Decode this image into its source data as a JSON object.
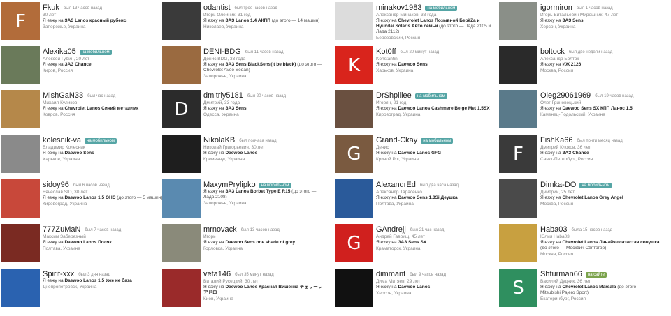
{
  "cards": [
    {
      "username": "Fkuk",
      "ago": "был 13 часов назад",
      "badge": "",
      "name": "30 лет",
      "car_prefix": "Я езжу на",
      "car": "ЗАЗ Lanos красный рубенс",
      "prev": "",
      "location": "Запорожье, Украина",
      "avatar_letter": "F",
      "avatar_color": "#b26c3a"
    },
    {
      "username": "odantist",
      "ago": "был трое часов назад",
      "badge": "",
      "name": "Игорь Олейник, 31 год",
      "car_prefix": "Я езжу на",
      "car": "ЗАЗ Lanos 1.4 АКПП",
      "prev": "(до этого — 14 машин)",
      "location": "Николаев, Украина",
      "avatar_letter": "",
      "avatar_color": "#3a3a3a"
    },
    {
      "username": "minakov1983",
      "ago": "",
      "badge": "на мобильном",
      "name": "Александр Минаков, 33 года",
      "car_prefix": "Я езжу на",
      "car": "Chevrolet Lanos Позывной БерёZа и Hyundai Solaris Авто семьи",
      "prev": "(до этого — Лада 2105 и Лада 2112)",
      "location": "Березовский, Россия",
      "avatar_letter": "",
      "avatar_color": "#dcdcdc"
    },
    {
      "username": "igormiron",
      "ago": "был 1 часов назад",
      "badge": "",
      "name": "Игорь Витальевич Мирошник, 47 лет",
      "car_prefix": "Я езжу на",
      "car": "ЗАЗ Sens",
      "prev": "",
      "location": "Херсон, Украина",
      "avatar_letter": "",
      "avatar_color": "#8a8f88"
    },
    {
      "username": "Alexika05",
      "ago": "",
      "badge": "на мобильном",
      "name": "Алексей Губин, 20 лет",
      "car_prefix": "Я езжу на",
      "car": "ЗАЗ Chance",
      "prev": "",
      "location": "Киров, Россия",
      "avatar_letter": "",
      "avatar_color": "#6a7a5a"
    },
    {
      "username": "DENI-BDG",
      "ago": "был 11 часов назад",
      "badge": "",
      "name": "Денис BDG, 33 года",
      "car_prefix": "Я езжу на",
      "car": "ЗАЗ Sens BlackSens(it be black)",
      "prev": "(до этого — Chevrolet Aveo Sedan)",
      "location": "Запорожье, Украина",
      "avatar_letter": "",
      "avatar_color": "#9a6a40"
    },
    {
      "username": "Kot0ff",
      "ago": "был 20 минут назад",
      "badge": "",
      "name": "Konstantin",
      "car_prefix": "Я езжу на",
      "car": "Daewoo Sens",
      "prev": "",
      "location": "Харьков, Украина",
      "avatar_letter": "K",
      "avatar_color": "#d9241c"
    },
    {
      "username": "boltock",
      "ago": "был две недели назад",
      "badge": "",
      "name": "Александр Болток",
      "car_prefix": "Я езжу на",
      "car": "ИЖ 2126",
      "prev": "",
      "location": "Москва, Россия",
      "avatar_letter": "",
      "avatar_color": "#2a2a2a"
    },
    {
      "username": "MishGaN33",
      "ago": "был час назад",
      "badge": "",
      "name": "Михаил Куликов",
      "car_prefix": "Я езжу на",
      "car": "Chevrolet Lanos Синий металлик",
      "prev": "",
      "location": "Ковров, Россия",
      "avatar_letter": "",
      "avatar_color": "#b5884a"
    },
    {
      "username": "dmitriy5181",
      "ago": "был 20 часов назад",
      "badge": "",
      "name": "Дмитрий, 33 года",
      "car_prefix": "Я езжу на",
      "car": "ЗАЗ Sens",
      "prev": "",
      "location": "Одесса, Украина",
      "avatar_letter": "D",
      "avatar_color": "#2b2b2b"
    },
    {
      "username": "DrShpiliee",
      "ago": "",
      "badge": "на мобильном",
      "name": "Игорян, 21 год",
      "car_prefix": "Я езжу на",
      "car": "Daewoo Lanos Cashmere Beige Met 1.5SX",
      "prev": "",
      "location": "Кировоград, Украина",
      "avatar_letter": "",
      "avatar_color": "#6a5040"
    },
    {
      "username": "Oleg29061969",
      "ago": "был 19 часов назад",
      "badge": "",
      "name": "Олег Гриневецький",
      "car_prefix": "Я езжу на",
      "car": "Daewoo Sens SX КПП Ланос 1,5",
      "prev": "",
      "location": "Каменец-Подольский, Украина",
      "avatar_letter": "",
      "avatar_color": "#5a7a8a"
    },
    {
      "username": "kolesnik-va",
      "ago": "",
      "badge": "на мобильном",
      "name": "Владимир Колесник",
      "car_prefix": "Я езжу на",
      "car": "Daewoo Sens",
      "prev": "",
      "location": "Харьков, Украина",
      "avatar_letter": "",
      "avatar_color": "#8a8a8a"
    },
    {
      "username": "NikolaKB",
      "ago": "был полчаса назад",
      "badge": "",
      "name": "Николай Григорьевич, 30 лет",
      "car_prefix": "Я езжу на",
      "car": "Daewoo Lanos",
      "prev": "",
      "location": "Кременчуг, Украина",
      "avatar_letter": "",
      "avatar_color": "#1e1e1e"
    },
    {
      "username": "Grand-Ckay",
      "ago": "",
      "badge": "на мобильном",
      "name": "Денис",
      "car_prefix": "Я езжу на",
      "car": "Daewoo Lanos GFG",
      "prev": "",
      "location": "Кривой Рог, Украина",
      "avatar_letter": "G",
      "avatar_color": "#7a5a40"
    },
    {
      "username": "FishKa66",
      "ago": "был почти месяц назад",
      "badge": "",
      "name": "Дмитрий Клоков, 36 лет",
      "car_prefix": "Я езжу на",
      "car": "ЗАЗ Chance",
      "prev": "",
      "location": "Санкт-Петербург, Россия",
      "avatar_letter": "F",
      "avatar_color": "#3a3a3a"
    },
    {
      "username": "sidoy96",
      "ago": "был 6 часов назад",
      "badge": "",
      "name": "Вячеслав SID, 30 лет",
      "car_prefix": "Я езжу на",
      "car": "Daewoo Lanos 1.5 OHC",
      "prev": "(до этого — 5 машин)",
      "location": "Кировоград, Украина",
      "avatar_letter": "",
      "avatar_color": "#c8483a"
    },
    {
      "username": "MaxymPrylipko",
      "ago": "",
      "badge": "на мобильном",
      "name": "",
      "car_prefix": "Я езжу на",
      "car": "ЗАЗ Lanos Borbet Type E R15",
      "prev": "(до этого — Лада 2108)",
      "location": "Запорожье, Украина",
      "avatar_letter": "",
      "avatar_color": "#5a8ab0"
    },
    {
      "username": "AlexandrEd",
      "ago": "был два часа назад",
      "badge": "",
      "name": "Александр Тарасенко",
      "car_prefix": "Я езжу на",
      "car": "Daewoo Sens 1.3Si Деушка",
      "prev": "",
      "location": "Полтава, Украина",
      "avatar_letter": "",
      "avatar_color": "#2a5a9a"
    },
    {
      "username": "Dimka-DO",
      "ago": "",
      "badge": "на мобильном",
      "name": "Дмитрий, 25 лет",
      "car_prefix": "Я езжу на",
      "car": "Chevrolet Lanos Grey Angel",
      "prev": "",
      "location": "Москва, Россия",
      "avatar_letter": "",
      "avatar_color": "#4a4a4a"
    },
    {
      "username": "777ZuMaN",
      "ago": "был 7 часов назад",
      "badge": "",
      "name": "Максим Заберезный",
      "car_prefix": "Я езжу на",
      "car": "Daewoo Lanos Поляк",
      "prev": "",
      "location": "Полтава, Украина",
      "avatar_letter": "",
      "avatar_color": "#7a2a22"
    },
    {
      "username": "mrnovack",
      "ago": "был 13 часов назад",
      "badge": "",
      "name": "Игорь",
      "car_prefix": "Я езжу на",
      "car": "Daewoo Sens one shade of grey",
      "prev": "",
      "location": "Горловка, Украина",
      "avatar_letter": "",
      "avatar_color": "#8a8a7a"
    },
    {
      "username": "GAndrejj",
      "ago": "был 21 час назад",
      "badge": "",
      "name": "Андрей Гаврищ, 45 лет",
      "car_prefix": "Я езжу на",
      "car": "ЗАЗ Sens SX",
      "prev": "",
      "location": "Краматорск, Украина",
      "avatar_letter": "G",
      "avatar_color": "#d0201e"
    },
    {
      "username": "Haba03",
      "ago": "была 15 часов назад",
      "badge": "",
      "name": "Юлия Haba03",
      "car_prefix": "Я езжу на",
      "car": "Chevrolet Lanos Ланайя-глазастая совушка",
      "prev": "(до этого — Москвич Святогор)",
      "location": "Москва, Россия",
      "avatar_letter": "",
      "avatar_color": "#c8a040"
    },
    {
      "username": "Spirit-xxx",
      "ago": "был 3 дня назад",
      "badge": "",
      "name": "",
      "car_prefix": "Я езжу на",
      "car": "Daewoo Lanos 1.5 Уже не база",
      "prev": "",
      "location": "Днепропетровск, Украина",
      "avatar_letter": "",
      "avatar_color": "#2a62b0"
    },
    {
      "username": "veta146",
      "ago": "был 35 минут назад",
      "badge": "",
      "name": "Виталий Русецкий, 30 лет",
      "car_prefix": "Я езжу на",
      "car": "Daewoo Lanos Красная Вишенка チェリーレアドロ",
      "prev": "",
      "location": "Киев, Украина",
      "avatar_letter": "",
      "avatar_color": "#9a2a2a"
    },
    {
      "username": "dimmant",
      "ago": "был 9 часов назад",
      "badge": "",
      "name": "Дима Митяев, 29 лет",
      "car_prefix": "Я езжу на",
      "car": "Daewoo Lanos",
      "prev": "",
      "location": "Херсон, Украина",
      "avatar_letter": "",
      "avatar_color": "#111111"
    },
    {
      "username": "Shturman66",
      "ago": "",
      "badge": "на сайте",
      "name": "Василий Дудник, 36 лет",
      "car_prefix": "Я езжу на",
      "car": "Chevrolet Lanos Marsala",
      "prev": "(до этого — Mitsubishi Pajero Sport)",
      "location": "Екатеринбург, Россия",
      "avatar_letter": "S",
      "avatar_color": "#2f8f5f"
    }
  ]
}
